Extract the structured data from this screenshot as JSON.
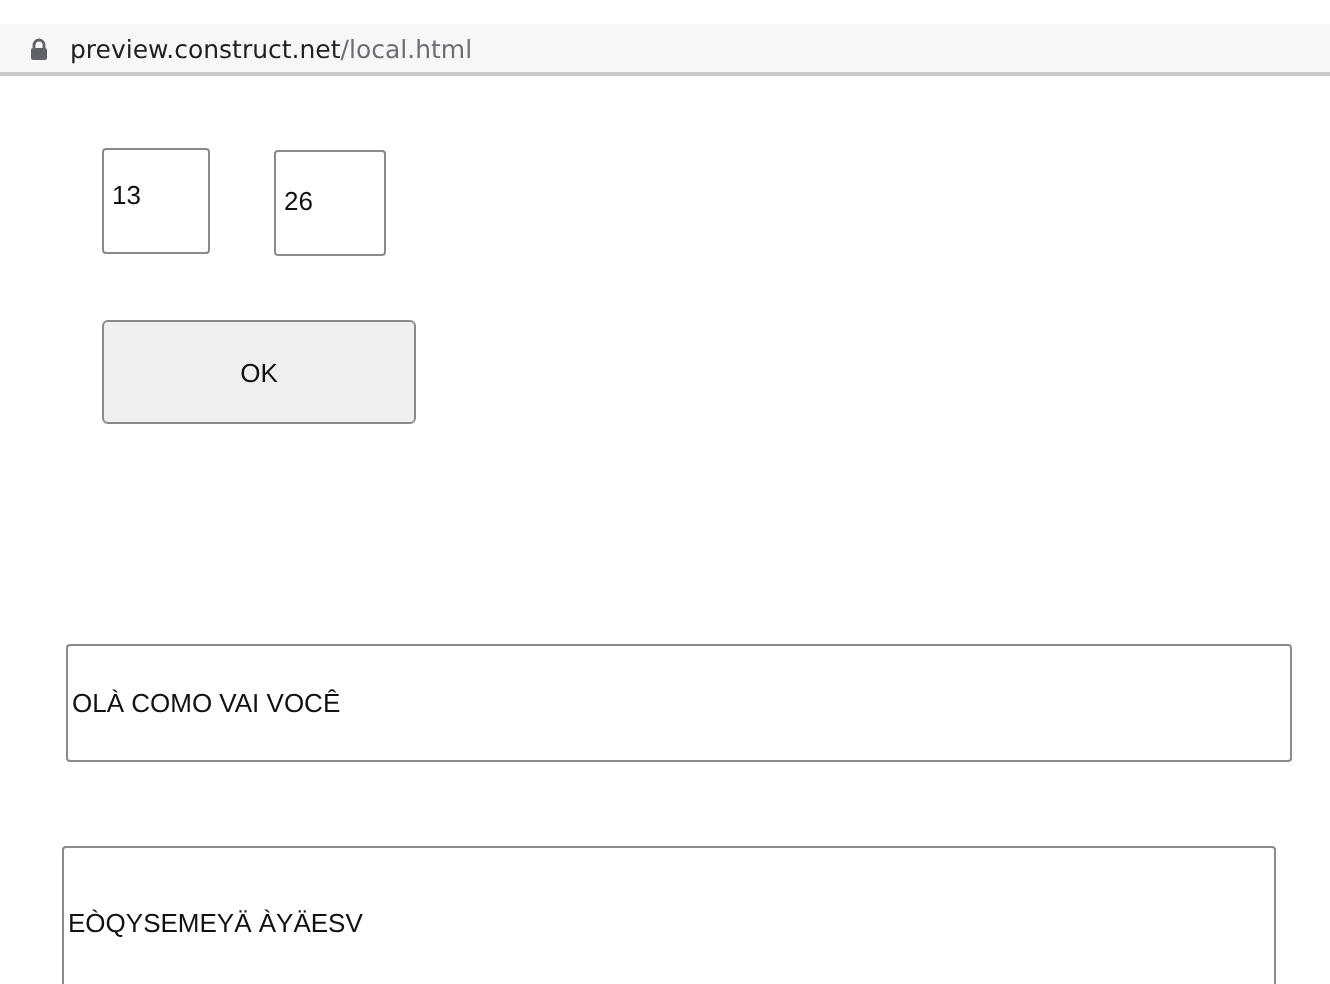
{
  "address_bar": {
    "host": "preview.construct.net",
    "path": "/local.html"
  },
  "number_fields": [
    {
      "value": "13"
    },
    {
      "value": "26"
    }
  ],
  "ok_button": {
    "label": "OK"
  },
  "text_fields": [
    {
      "value": "OLÀ COMO VAI VOCÊ"
    },
    {
      "value": "EÒQYSEMEYÄ ÀYÄESV"
    }
  ]
}
